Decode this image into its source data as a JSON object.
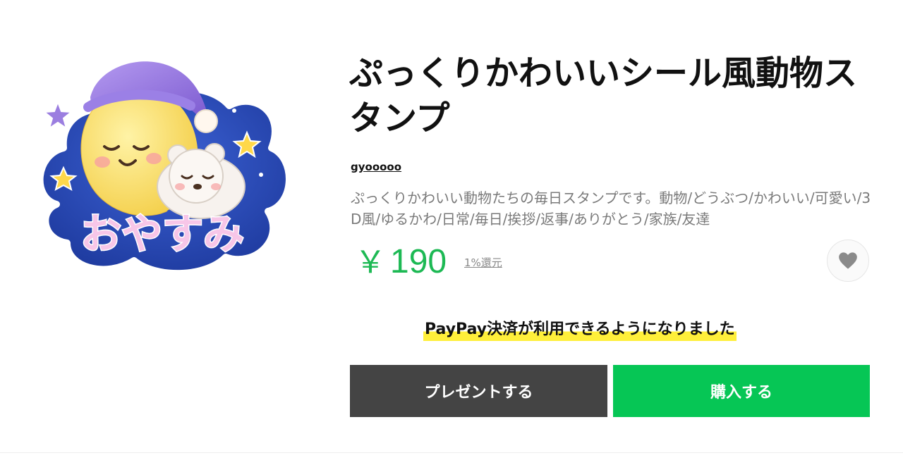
{
  "product": {
    "title": "ぷっくりかわいいシール風動物スタンプ",
    "author": "gyooooo",
    "description": "ぷっくりかわいい動物たちの毎日スタンプです。動物/どうぶつ/かわいい/可愛い/3D風/ゆるかわ/日常/毎日/挨拶/返事/ありがとう/家族/友達",
    "price_symbol": "￥",
    "price_value": "190",
    "cashback": "1%還元"
  },
  "sticker": {
    "text": "おやすみ",
    "icon": "sleeping-moon-bear-sticker"
  },
  "favorite": {
    "icon": "heart-icon"
  },
  "notice": {
    "text": "PayPay決済が利用できるようになりました"
  },
  "actions": {
    "gift_label": "プレゼントする",
    "buy_label": "購入する"
  },
  "colors": {
    "price": "#1db954",
    "buy_button": "#06c655",
    "gift_button": "#444444",
    "highlight": "#ffef3a",
    "description": "#7a7a7a"
  }
}
